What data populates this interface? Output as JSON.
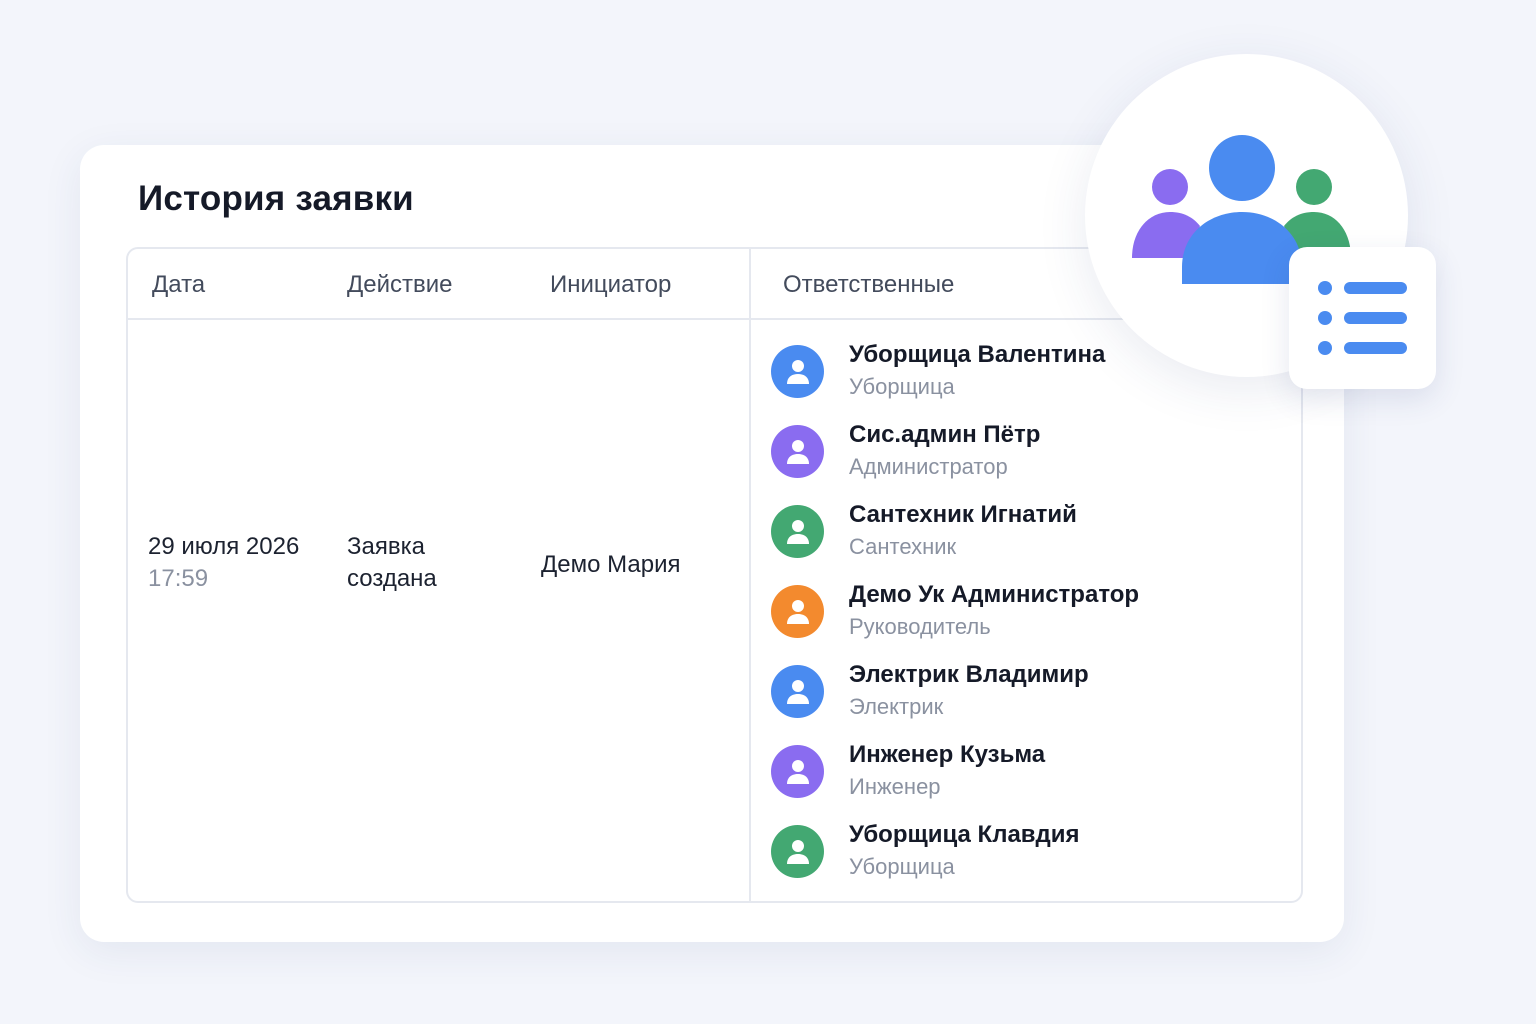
{
  "card": {
    "title": "История заявки"
  },
  "table": {
    "headers": {
      "date": "Дата",
      "action": "Действие",
      "initiator": "Инициатор",
      "responsible": "Ответственные"
    },
    "row": {
      "date": "29 июля 2026",
      "time": "17:59",
      "action_line1": "Заявка",
      "action_line2": "создана",
      "initiator": "Демо Мария"
    },
    "responsible": [
      {
        "name": "Уборщица Валентина",
        "role": "Уборщица",
        "color": "#4a8bf0"
      },
      {
        "name": "Сис.админ Пётр",
        "role": "Администратор",
        "color": "#8a6cf0"
      },
      {
        "name": "Сантехник Игнатий",
        "role": "Сантехник",
        "color": "#43a872"
      },
      {
        "name": "Демо Ук Администратор",
        "role": "Руководитель",
        "color": "#f38a2e"
      },
      {
        "name": "Электрик Владимир",
        "role": "Электрик",
        "color": "#4a8bf0"
      },
      {
        "name": "Инженер Кузьма",
        "role": "Инженер",
        "color": "#8a6cf0"
      },
      {
        "name": "Уборщица Клавдия",
        "role": "Уборщица",
        "color": "#43a872"
      }
    ]
  },
  "icons": {
    "hero": "users-group-icon",
    "badge": "list-icon",
    "avatar": "user-icon"
  },
  "colors": {
    "blue": "#4a8bf0",
    "purple": "#8a6cf0",
    "green": "#43a872",
    "orange": "#f38a2e"
  }
}
